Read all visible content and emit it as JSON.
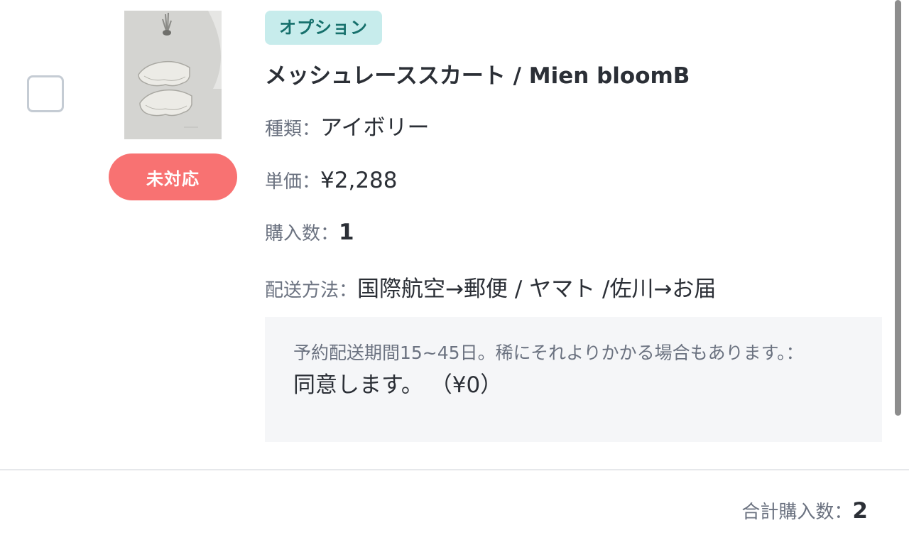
{
  "order_item": {
    "status_label": "未対応",
    "option_badge": "オプション",
    "product_title": "メッシュレーススカート / Mien bloomB",
    "type_label": "種類：",
    "type_value": "アイボリー",
    "price_label": "単価：",
    "price_value": "¥2,288",
    "quantity_label": "購入数：",
    "quantity_value": "1",
    "shipping_label": "配送方法：",
    "shipping_value": "国際航空→郵便 / ヤマト /佐川→お届",
    "option": {
      "question": "予約配送期間15~45日。稀にそれよりかかる場合もあります。：",
      "answer": "同意します。 （¥0）"
    }
  },
  "summary": {
    "total_label": "合計購入数：",
    "total_value": "2"
  },
  "colors": {
    "status_pill": "#f87272",
    "option_badge_bg": "#c7ecec",
    "option_badge_text": "#16706c",
    "option_box_bg": "#f5f6f8"
  },
  "icons": {
    "checkbox": "checkbox-unchecked-icon",
    "product_image": "skirt-product-thumbnail"
  }
}
